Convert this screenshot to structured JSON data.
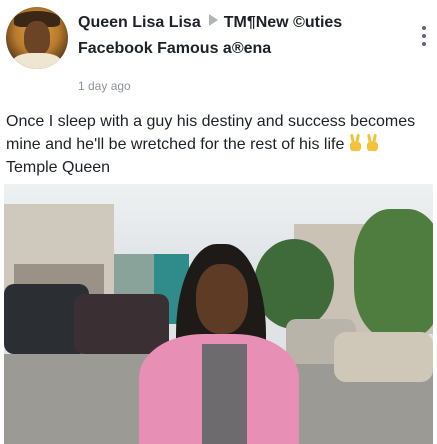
{
  "post": {
    "author": "Queen Lisa Lisa",
    "group_line1": "TM¶New ©uties",
    "group_line2": "Facebook Famous a®ena",
    "timestamp": "1 day ago",
    "text_before_emoji": "Once I sleep with a guy his destiny and success becomes mine and he'll be wretched for the rest of his life",
    "text_after_emoji": "Temple Queen"
  },
  "icons": {
    "arrow": "arrow-right-icon",
    "menu": "more-vertical-icon",
    "emoji": "victory-hand-emoji"
  }
}
